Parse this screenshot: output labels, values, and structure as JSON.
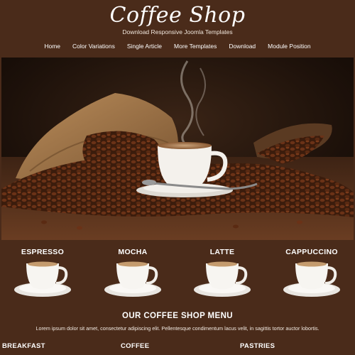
{
  "header": {
    "logo": "Coffee Shop",
    "tagline": "Download Responsive Joomla Templates"
  },
  "nav": {
    "items": [
      "Home",
      "Color Variations",
      "Single Article",
      "More Templates",
      "Download",
      "Module Position"
    ]
  },
  "hero": {
    "image": "coffee-cup-and-beans"
  },
  "products": [
    "ESPRESSO",
    "MOCHA",
    "LATTE",
    "CAPPUCCINO"
  ],
  "menu": {
    "title": "OUR COFFEE SHOP MENU",
    "text": "Lorem ipsum dolor sit amet, consectetur adipiscing elit. Pellentesque condimentum lacus velit, in sagittis tortor auctor lobortis."
  },
  "categories": [
    "BREAKFAST",
    "COFFEE",
    "PASTRIES"
  ],
  "colors": {
    "background": "#4a2b1a",
    "text": "#ffffff"
  }
}
